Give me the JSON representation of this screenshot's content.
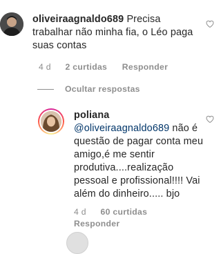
{
  "comments": [
    {
      "username": "oliveiraagnaldo689",
      "text": "Precisa trabalhar não minha fia, o Léo paga suas contas",
      "time": "4 d",
      "likes": "2 curtidas",
      "reply_label": "Responder",
      "avatar_icon": "profile-avatar-dark"
    }
  ],
  "hide_replies_label": "Ocultar respostas",
  "reply": {
    "username": "poliana",
    "mention": "@oliveiraagnaldo689",
    "text": " não é questão de pagar conta meu amigo,é me sentir produtiva....realização pessoal e profissional!!!! Vai além do dinheiro..... bjo",
    "time": "4 d",
    "likes": "60 curtidas",
    "reply_label": "Responder",
    "avatar_icon": "profile-avatar-story-ring"
  },
  "icons": {
    "like": "heart-outline-icon"
  },
  "colors": {
    "text": "#262626",
    "secondary": "#8e8e8e",
    "mention": "#003569",
    "story_ring": "#d6249f"
  }
}
